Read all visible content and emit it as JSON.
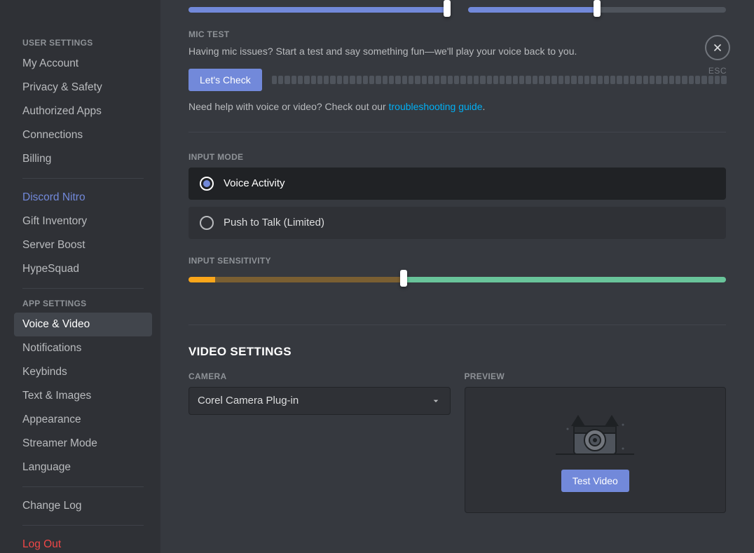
{
  "sidebar": {
    "user_settings_header": "USER SETTINGS",
    "user_items": [
      "My Account",
      "Privacy & Safety",
      "Authorized Apps",
      "Connections",
      "Billing"
    ],
    "nitro_items": [
      "Discord Nitro",
      "Gift Inventory",
      "Server Boost",
      "HypeSquad"
    ],
    "app_settings_header": "APP SETTINGS",
    "app_items": [
      "Voice & Video",
      "Notifications",
      "Keybinds",
      "Text & Images",
      "Appearance",
      "Streamer Mode",
      "Language"
    ],
    "selected_app_item": "Voice & Video",
    "change_log": "Change Log",
    "log_out": "Log Out"
  },
  "top_sliders": {
    "slider_a_percent": 100,
    "slider_b_percent": 50
  },
  "mic_test": {
    "label": "MIC TEST",
    "desc": "Having mic issues? Start a test and say something fun—we'll play your voice back to you.",
    "button": "Let's Check",
    "help_prefix": "Need help with voice or video? Check out our ",
    "help_link": "troubleshooting guide",
    "help_suffix": "."
  },
  "input_mode": {
    "label": "INPUT MODE",
    "options": [
      "Voice Activity",
      "Push to Talk (Limited)"
    ],
    "selected_index": 0
  },
  "input_sensitivity": {
    "label": "INPUT SENSITIVITY",
    "active_percent": 5,
    "threshold_percent": 40
  },
  "video": {
    "heading": "VIDEO SETTINGS",
    "camera_label": "CAMERA",
    "camera_value": "Corel Camera Plug-in",
    "preview_label": "PREVIEW",
    "test_button": "Test Video"
  },
  "close": {
    "esc": "ESC"
  }
}
